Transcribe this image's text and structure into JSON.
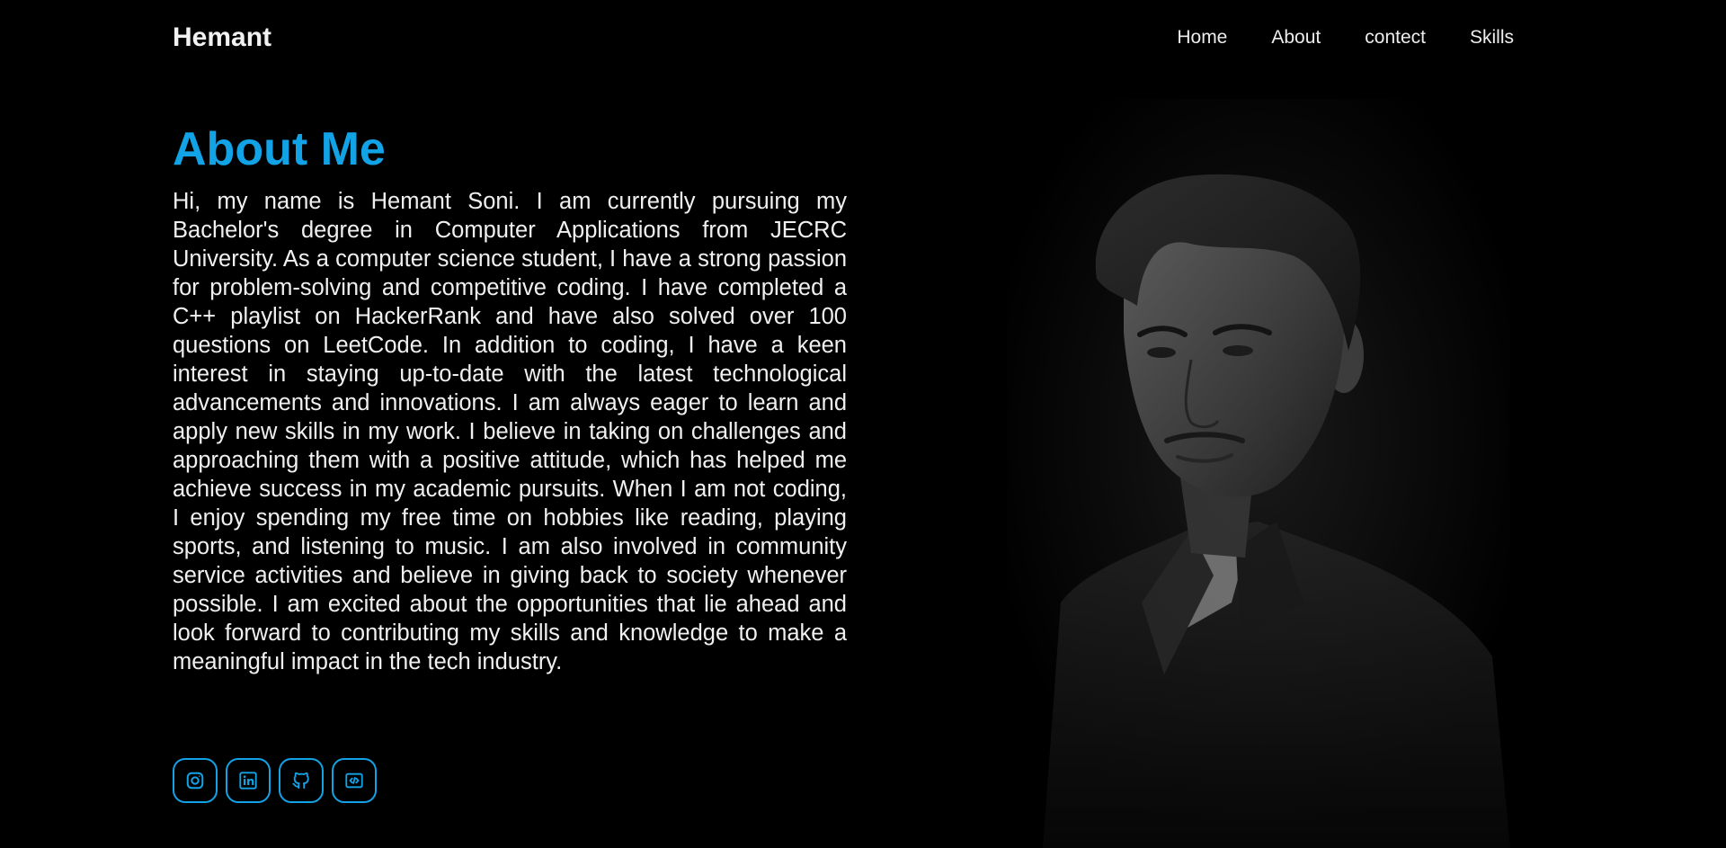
{
  "nav": {
    "brand": "Hemant",
    "links": [
      "Home",
      "About",
      "contect",
      "Skills"
    ]
  },
  "about": {
    "title": "About Me",
    "text": "Hi, my name is Hemant Soni. I am currently pursuing my Bachelor's degree in Computer Applications from JECRC University. As a computer science student, I have a strong passion for problem-solving and competitive coding. I have completed a C++ playlist on HackerRank and have also solved over 100 questions on LeetCode. In addition to coding, I have a keen interest in staying up-to-date with the latest technological advancements and innovations. I am always eager to learn and apply new skills in my work. I believe in taking on challenges and approaching them with a positive attitude, which has helped me achieve success in my academic pursuits. When I am not coding, I enjoy spending my free time on hobbies like reading, playing sports, and listening to music. I am also involved in community service activities and believe in giving back to society whenever possible. I am excited about the opportunities that lie ahead and look forward to contributing my skills and knowledge to make a meaningful impact in the tech industry."
  },
  "social": {
    "icons": [
      "instagram-icon",
      "linkedin-icon",
      "github-icon",
      "code-icon"
    ]
  },
  "colors": {
    "background": "#000000",
    "accent": "#12a3e6",
    "text": "#f0f0f0"
  }
}
